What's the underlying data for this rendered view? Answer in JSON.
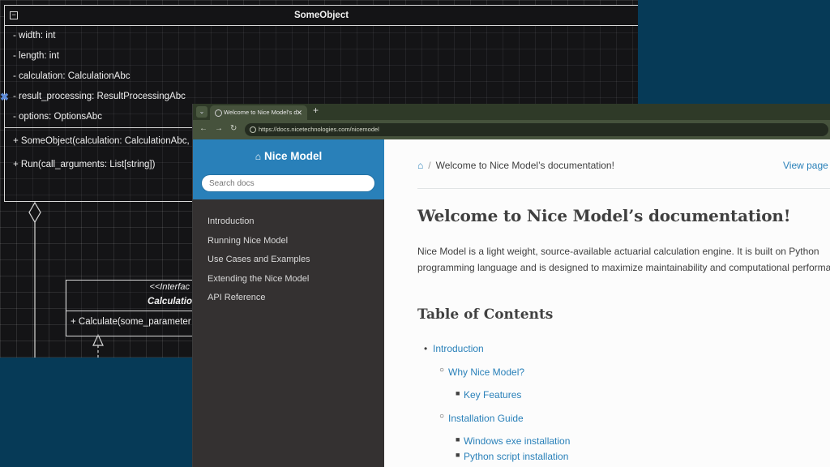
{
  "uml": {
    "class_name": "SomeObject",
    "attributes": [
      "- width: int",
      "- length: int",
      "- calculation: CalculationAbc",
      "- result_processing: ResultProcessingAbc",
      "- options: OptionsAbc"
    ],
    "operations": [
      "+ SomeObject(calculation: CalculationAbc, r",
      "+ Run(call_arguments: List[string])"
    ],
    "interface": {
      "stereotype": "<<Interfac",
      "name": "Calculatio",
      "operation": "+ Calculate(some_parameter"
    }
  },
  "browser": {
    "tab_title": "Welcome to Nice Model's doc",
    "new_tab": "+",
    "url": "https://docs.nicetechnologies.com/nicemodel"
  },
  "sidebar": {
    "brand": "Nice Model",
    "search_placeholder": "Search docs",
    "items": [
      {
        "label": "Introduction"
      },
      {
        "label": "Running Nice Model"
      },
      {
        "label": "Use Cases and Examples"
      },
      {
        "label": "Extending the Nice Model"
      },
      {
        "label": "API Reference"
      }
    ]
  },
  "content": {
    "breadcrumb": "Welcome to Nice Model’s documentation!",
    "view_page": "View page",
    "title": "Welcome to Nice Model’s documentation!",
    "intro": "Nice Model is a light weight, source-available actuarial calculation engine. It is built on Python programming language and is designed to maximize maintainability and computational performance.",
    "toc_heading": "Table of Contents",
    "toc": {
      "introduction": "Introduction",
      "why": "Why Nice Model?",
      "features": "Key Features",
      "install": "Installation Guide",
      "windows": "Windows exe installation",
      "python": "Python script installation"
    }
  },
  "colors": {
    "accent": "#2980b9",
    "sidebar_bg": "#343131",
    "background": "#063a57",
    "uml_canvas": "#141416"
  }
}
